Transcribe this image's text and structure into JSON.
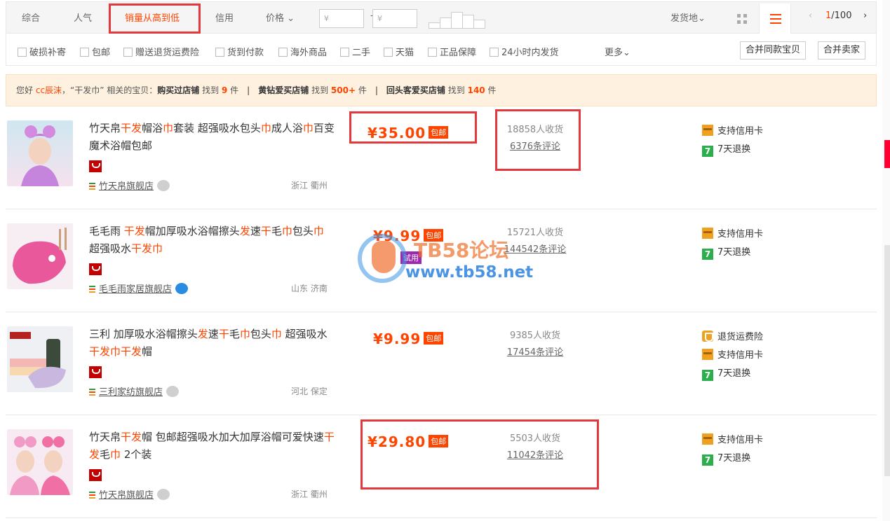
{
  "sort": {
    "items": [
      "综合",
      "人气",
      "销量从高到低",
      "信用",
      "价格"
    ],
    "price_min_placeholder": "¥",
    "price_max_placeholder": "¥",
    "dash": "-",
    "origin": "发货地",
    "chevron": "⌄",
    "page": {
      "current": "1",
      "total": "/100",
      "prev": "‹",
      "next": "›"
    }
  },
  "filters": {
    "items": [
      "破损补寄",
      "包邮",
      "赠送退货运费险",
      "货到付款",
      "海外商品",
      "二手",
      "天猫",
      "正品保障",
      "24小时内发货"
    ],
    "more": "更多",
    "merge_same": "合并同款宝贝",
    "merge_seller": "合并卖家"
  },
  "tip": {
    "greeting": "您好",
    "user": "cc辰沫",
    "query": "，“干发巾” 相关的宝贝：",
    "g1_label": "购买过店铺",
    "g1_pre": "找到",
    "g1_count": "9",
    "g1_unit": "件",
    "g2_label": "黄钻爱买店铺",
    "g2_pre": "找到",
    "g2_count": "500+",
    "g2_unit": "件",
    "g3_label": "回头客爱买店铺",
    "g3_pre": "找到",
    "g3_count": "140",
    "g3_unit": "件",
    "sep": "|"
  },
  "products": [
    {
      "title_parts": [
        "竹天帛",
        "干发",
        "帽浴",
        "巾",
        "套装 超强吸水包头",
        "巾",
        "成人浴",
        "巾",
        "百变魔术浴帽包邮"
      ],
      "shop": "竹天帛旗舰店",
      "location": "浙江 衢州",
      "price": "¥35.00",
      "tag": "包邮",
      "sold": "18858人收货",
      "reviews": "6376条评论",
      "services": [
        "支持信用卡",
        "7天退换"
      ]
    },
    {
      "title_parts": [
        "毛毛雨 ",
        "干发",
        "帽加厚吸水浴帽擦头",
        "发",
        "速",
        "干",
        "毛",
        "巾",
        "包头",
        "巾",
        " 超强吸水",
        "干发巾"
      ],
      "shop": "毛毛雨家居旗舰店",
      "location": "山东 济南",
      "price": "¥9.99",
      "tag": "包邮",
      "trial": "试用",
      "sold": "15721人收货",
      "reviews": "144542条评论",
      "services": [
        "支持信用卡",
        "7天退换"
      ]
    },
    {
      "title_parts": [
        "三利 加厚吸水浴帽擦头",
        "发",
        "速",
        "干",
        "毛",
        "巾",
        "包头",
        "巾",
        " 超强吸水",
        "干发巾干发",
        "帽"
      ],
      "shop": "三利家纺旗舰店",
      "location": "河北 保定",
      "price": "¥9.99",
      "tag": "包邮",
      "sold": "9385人收货",
      "reviews": "17454条评论",
      "services": [
        "退货运费险",
        "支持信用卡",
        "7天退换"
      ]
    },
    {
      "title_parts": [
        "竹天帛",
        "干发",
        "帽 包邮超强吸水加大加厚浴帽可爱快速",
        "干发",
        "毛",
        "巾",
        " 2个装"
      ],
      "shop": "竹天帛旗舰店",
      "location": "浙江 衢州",
      "price": "¥29.80",
      "tag": "包邮",
      "sold": "5503人收货",
      "reviews": "11042条评论",
      "services": [
        "支持信用卡",
        "7天退换"
      ]
    }
  ],
  "watermark": {
    "line1": "TB58论坛",
    "line2": "www.tb58.net"
  },
  "colors": {
    "accent": "#ff4400",
    "highlight_box": "#e4393c",
    "tip_bg": "#fef1e0",
    "tmall_red": "#c40000"
  },
  "icons": [
    "grid-view-icon",
    "list-view-icon",
    "tmall-icon",
    "credit-card-icon",
    "seven-day-return-icon",
    "return-insurance-icon",
    "wangwang-icon"
  ]
}
